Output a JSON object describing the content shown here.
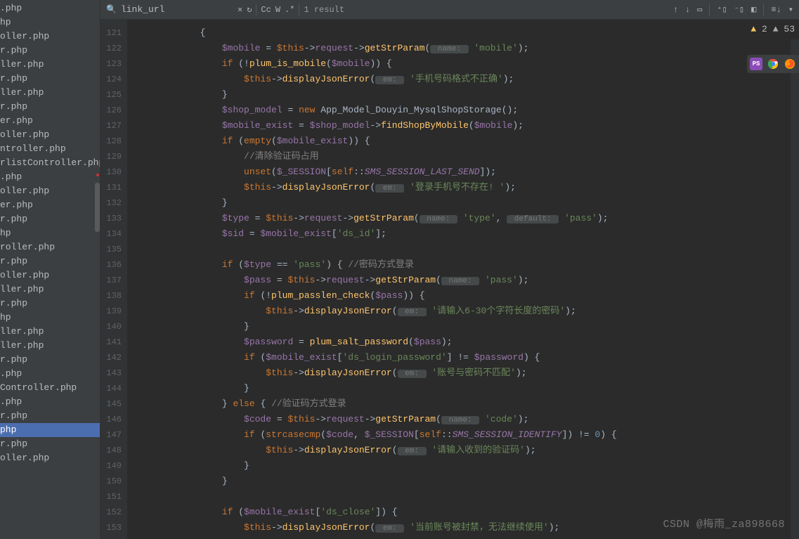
{
  "sidebar_files": [
    ".php",
    "hp",
    "oller.php",
    "r.php",
    "ller.php",
    "r.php",
    "ller.php",
    "r.php",
    "er.php",
    "oller.php",
    "ntroller.php",
    "rlistController.php",
    ".php",
    "oller.php",
    "er.php",
    "r.php",
    "hp",
    "roller.php",
    "r.php",
    "oller.php",
    "ller.php",
    "r.php",
    "hp",
    "ller.php",
    "ller.php",
    "r.php",
    ".php",
    "Controller.php",
    ".php",
    "r.php",
    "php",
    "r.php",
    "oller.php"
  ],
  "active_file_index": 30,
  "search": {
    "value": "link_url",
    "placeholder": ""
  },
  "result_text": "1 result",
  "warnings": {
    "yellow": "2",
    "gray": "53"
  },
  "watermark": "CSDN @梅雨_za898668",
  "gutter_start": 121,
  "gutter_count": 33,
  "code_lines": [
    [
      {
        "t": "            {",
        "c": "punct"
      }
    ],
    [
      {
        "t": "                ",
        "c": ""
      },
      {
        "t": "$mobile",
        "c": "var"
      },
      {
        "t": " = ",
        "c": "punct"
      },
      {
        "t": "$this",
        "c": "kw"
      },
      {
        "t": "->",
        "c": "punct"
      },
      {
        "t": "request",
        "c": "var"
      },
      {
        "t": "->",
        "c": "punct"
      },
      {
        "t": "getStrParam",
        "c": "method"
      },
      {
        "t": "(",
        "c": "punct"
      },
      {
        "t": " name: ",
        "c": "hint-box"
      },
      {
        "t": " ",
        "c": ""
      },
      {
        "t": "'mobile'",
        "c": "str"
      },
      {
        "t": ");",
        "c": "punct"
      }
    ],
    [
      {
        "t": "                ",
        "c": ""
      },
      {
        "t": "if",
        "c": "kw"
      },
      {
        "t": " (!",
        "c": "punct"
      },
      {
        "t": "plum_is_mobile",
        "c": "func"
      },
      {
        "t": "(",
        "c": "punct"
      },
      {
        "t": "$mobile",
        "c": "var"
      },
      {
        "t": ")) {",
        "c": "punct"
      }
    ],
    [
      {
        "t": "                    ",
        "c": ""
      },
      {
        "t": "$this",
        "c": "kw"
      },
      {
        "t": "->",
        "c": "punct"
      },
      {
        "t": "displayJsonError",
        "c": "method"
      },
      {
        "t": "(",
        "c": "punct"
      },
      {
        "t": " em: ",
        "c": "hint-box"
      },
      {
        "t": " ",
        "c": ""
      },
      {
        "t": "'手机号码格式不正确'",
        "c": "str"
      },
      {
        "t": ");",
        "c": "punct"
      }
    ],
    [
      {
        "t": "                }",
        "c": "punct"
      }
    ],
    [
      {
        "t": "                ",
        "c": ""
      },
      {
        "t": "$shop_model",
        "c": "var"
      },
      {
        "t": " = ",
        "c": "punct"
      },
      {
        "t": "new ",
        "c": "kw"
      },
      {
        "t": "App_Model_Douyin_MysqlShopStorage",
        "c": "classname"
      },
      {
        "t": "();",
        "c": "punct"
      }
    ],
    [
      {
        "t": "                ",
        "c": ""
      },
      {
        "t": "$mobile_exist",
        "c": "var"
      },
      {
        "t": " = ",
        "c": "punct"
      },
      {
        "t": "$shop_model",
        "c": "var"
      },
      {
        "t": "->",
        "c": "punct"
      },
      {
        "t": "findShopByMobile",
        "c": "method"
      },
      {
        "t": "(",
        "c": "punct"
      },
      {
        "t": "$mobile",
        "c": "var"
      },
      {
        "t": ");",
        "c": "punct"
      }
    ],
    [
      {
        "t": "                ",
        "c": ""
      },
      {
        "t": "if",
        "c": "kw"
      },
      {
        "t": " (",
        "c": "punct"
      },
      {
        "t": "empty",
        "c": "kw"
      },
      {
        "t": "(",
        "c": "punct"
      },
      {
        "t": "$mobile_exist",
        "c": "var"
      },
      {
        "t": ")) {",
        "c": "punct"
      }
    ],
    [
      {
        "t": "                    ",
        "c": ""
      },
      {
        "t": "//清除验证码占用",
        "c": "comment"
      }
    ],
    [
      {
        "t": "                    ",
        "c": ""
      },
      {
        "t": "unset",
        "c": "kw"
      },
      {
        "t": "(",
        "c": "punct"
      },
      {
        "t": "$_SESSION",
        "c": "var"
      },
      {
        "t": "[",
        "c": "punct"
      },
      {
        "t": "self",
        "c": "kw"
      },
      {
        "t": "::",
        "c": "punct"
      },
      {
        "t": "SMS_SESSION_LAST_SEND",
        "c": "const"
      },
      {
        "t": "]);",
        "c": "punct"
      }
    ],
    [
      {
        "t": "                    ",
        "c": ""
      },
      {
        "t": "$this",
        "c": "kw"
      },
      {
        "t": "->",
        "c": "punct"
      },
      {
        "t": "displayJsonError",
        "c": "method"
      },
      {
        "t": "(",
        "c": "punct"
      },
      {
        "t": " em: ",
        "c": "hint-box"
      },
      {
        "t": " ",
        "c": ""
      },
      {
        "t": "'登录手机号不存在! '",
        "c": "str"
      },
      {
        "t": ");",
        "c": "punct"
      }
    ],
    [
      {
        "t": "                }",
        "c": "punct"
      }
    ],
    [
      {
        "t": "                ",
        "c": ""
      },
      {
        "t": "$type",
        "c": "var"
      },
      {
        "t": " = ",
        "c": "punct"
      },
      {
        "t": "$this",
        "c": "kw"
      },
      {
        "t": "->",
        "c": "punct"
      },
      {
        "t": "request",
        "c": "var"
      },
      {
        "t": "->",
        "c": "punct"
      },
      {
        "t": "getStrParam",
        "c": "method"
      },
      {
        "t": "(",
        "c": "punct"
      },
      {
        "t": " name: ",
        "c": "hint-box"
      },
      {
        "t": " ",
        "c": ""
      },
      {
        "t": "'type'",
        "c": "str"
      },
      {
        "t": ", ",
        "c": "punct"
      },
      {
        "t": " default: ",
        "c": "hint-box"
      },
      {
        "t": " ",
        "c": ""
      },
      {
        "t": "'pass'",
        "c": "str"
      },
      {
        "t": ");",
        "c": "punct"
      }
    ],
    [
      {
        "t": "                ",
        "c": ""
      },
      {
        "t": "$sid",
        "c": "var"
      },
      {
        "t": " = ",
        "c": "punct"
      },
      {
        "t": "$mobile_exist",
        "c": "var"
      },
      {
        "t": "[",
        "c": "punct"
      },
      {
        "t": "'ds_id'",
        "c": "str"
      },
      {
        "t": "];",
        "c": "punct"
      }
    ],
    [
      {
        "t": "",
        "c": ""
      }
    ],
    [
      {
        "t": "                ",
        "c": ""
      },
      {
        "t": "if",
        "c": "kw"
      },
      {
        "t": " (",
        "c": "punct"
      },
      {
        "t": "$type",
        "c": "var"
      },
      {
        "t": " == ",
        "c": "punct"
      },
      {
        "t": "'pass'",
        "c": "str"
      },
      {
        "t": ") { ",
        "c": "punct"
      },
      {
        "t": "//密码方式登录",
        "c": "comment"
      }
    ],
    [
      {
        "t": "                    ",
        "c": ""
      },
      {
        "t": "$pass",
        "c": "var"
      },
      {
        "t": " = ",
        "c": "punct"
      },
      {
        "t": "$this",
        "c": "kw"
      },
      {
        "t": "->",
        "c": "punct"
      },
      {
        "t": "request",
        "c": "var"
      },
      {
        "t": "->",
        "c": "punct"
      },
      {
        "t": "getStrParam",
        "c": "method"
      },
      {
        "t": "(",
        "c": "punct"
      },
      {
        "t": " name: ",
        "c": "hint-box"
      },
      {
        "t": " ",
        "c": ""
      },
      {
        "t": "'pass'",
        "c": "str"
      },
      {
        "t": ");",
        "c": "punct"
      }
    ],
    [
      {
        "t": "                    ",
        "c": ""
      },
      {
        "t": "if",
        "c": "kw"
      },
      {
        "t": " (!",
        "c": "punct"
      },
      {
        "t": "plum_passlen_check",
        "c": "func"
      },
      {
        "t": "(",
        "c": "punct"
      },
      {
        "t": "$pass",
        "c": "var"
      },
      {
        "t": ")) {",
        "c": "punct"
      }
    ],
    [
      {
        "t": "                        ",
        "c": ""
      },
      {
        "t": "$this",
        "c": "kw"
      },
      {
        "t": "->",
        "c": "punct"
      },
      {
        "t": "displayJsonError",
        "c": "method"
      },
      {
        "t": "(",
        "c": "punct"
      },
      {
        "t": " em: ",
        "c": "hint-box"
      },
      {
        "t": " ",
        "c": ""
      },
      {
        "t": "'请输入6-30个字符长度的密码'",
        "c": "str"
      },
      {
        "t": ");",
        "c": "punct"
      }
    ],
    [
      {
        "t": "                    }",
        "c": "punct"
      }
    ],
    [
      {
        "t": "                    ",
        "c": ""
      },
      {
        "t": "$password",
        "c": "var"
      },
      {
        "t": " = ",
        "c": "punct"
      },
      {
        "t": "plum_salt_password",
        "c": "func"
      },
      {
        "t": "(",
        "c": "punct"
      },
      {
        "t": "$pass",
        "c": "var"
      },
      {
        "t": ");",
        "c": "punct"
      }
    ],
    [
      {
        "t": "                    ",
        "c": ""
      },
      {
        "t": "if",
        "c": "kw"
      },
      {
        "t": " (",
        "c": "punct"
      },
      {
        "t": "$mobile_exist",
        "c": "var"
      },
      {
        "t": "[",
        "c": "punct"
      },
      {
        "t": "'ds_login_password'",
        "c": "str"
      },
      {
        "t": "] != ",
        "c": "punct"
      },
      {
        "t": "$password",
        "c": "var"
      },
      {
        "t": ") {",
        "c": "punct"
      }
    ],
    [
      {
        "t": "                        ",
        "c": ""
      },
      {
        "t": "$this",
        "c": "kw"
      },
      {
        "t": "->",
        "c": "punct"
      },
      {
        "t": "displayJsonError",
        "c": "method"
      },
      {
        "t": "(",
        "c": "punct"
      },
      {
        "t": " em: ",
        "c": "hint-box"
      },
      {
        "t": " ",
        "c": ""
      },
      {
        "t": "'账号与密码不匹配'",
        "c": "str"
      },
      {
        "t": ");",
        "c": "punct"
      }
    ],
    [
      {
        "t": "                    }",
        "c": "punct"
      }
    ],
    [
      {
        "t": "                } ",
        "c": "punct"
      },
      {
        "t": "else",
        "c": "kw"
      },
      {
        "t": " { ",
        "c": "punct"
      },
      {
        "t": "//验证码方式登录",
        "c": "comment"
      }
    ],
    [
      {
        "t": "                    ",
        "c": ""
      },
      {
        "t": "$code",
        "c": "var"
      },
      {
        "t": " = ",
        "c": "punct"
      },
      {
        "t": "$this",
        "c": "kw"
      },
      {
        "t": "->",
        "c": "punct"
      },
      {
        "t": "request",
        "c": "var"
      },
      {
        "t": "->",
        "c": "punct"
      },
      {
        "t": "getStrParam",
        "c": "method"
      },
      {
        "t": "(",
        "c": "punct"
      },
      {
        "t": " name: ",
        "c": "hint-box"
      },
      {
        "t": " ",
        "c": ""
      },
      {
        "t": "'code'",
        "c": "str"
      },
      {
        "t": ");",
        "c": "punct"
      }
    ],
    [
      {
        "t": "                    ",
        "c": ""
      },
      {
        "t": "if",
        "c": "kw"
      },
      {
        "t": " (",
        "c": "punct"
      },
      {
        "t": "strcasecmp",
        "c": "kw"
      },
      {
        "t": "(",
        "c": "punct"
      },
      {
        "t": "$code",
        "c": "var"
      },
      {
        "t": ", ",
        "c": "punct"
      },
      {
        "t": "$_SESSION",
        "c": "var"
      },
      {
        "t": "[",
        "c": "punct"
      },
      {
        "t": "self",
        "c": "kw"
      },
      {
        "t": "::",
        "c": "punct"
      },
      {
        "t": "SMS_SESSION_IDENTIFY",
        "c": "const"
      },
      {
        "t": "]) != ",
        "c": "punct"
      },
      {
        "t": "0",
        "c": "num"
      },
      {
        "t": ") {",
        "c": "punct"
      }
    ],
    [
      {
        "t": "                        ",
        "c": ""
      },
      {
        "t": "$this",
        "c": "kw"
      },
      {
        "t": "->",
        "c": "punct"
      },
      {
        "t": "displayJsonError",
        "c": "method"
      },
      {
        "t": "(",
        "c": "punct"
      },
      {
        "t": " em: ",
        "c": "hint-box"
      },
      {
        "t": " ",
        "c": ""
      },
      {
        "t": "'请输入收到的验证码'",
        "c": "str"
      },
      {
        "t": ");",
        "c": "punct"
      }
    ],
    [
      {
        "t": "                    }",
        "c": "punct"
      }
    ],
    [
      {
        "t": "                }",
        "c": "punct"
      }
    ],
    [
      {
        "t": "",
        "c": ""
      }
    ],
    [
      {
        "t": "                ",
        "c": ""
      },
      {
        "t": "if",
        "c": "kw"
      },
      {
        "t": " (",
        "c": "punct"
      },
      {
        "t": "$mobile_exist",
        "c": "var"
      },
      {
        "t": "[",
        "c": "punct"
      },
      {
        "t": "'ds_close'",
        "c": "str"
      },
      {
        "t": "]) {",
        "c": "punct"
      }
    ],
    [
      {
        "t": "                    ",
        "c": ""
      },
      {
        "t": "$this",
        "c": "kw"
      },
      {
        "t": "->",
        "c": "punct"
      },
      {
        "t": "displayJsonError",
        "c": "method"
      },
      {
        "t": "(",
        "c": "punct"
      },
      {
        "t": " em: ",
        "c": "hint-box"
      },
      {
        "t": " ",
        "c": ""
      },
      {
        "t": "'当前账号被封禁，无法继续使用'",
        "c": "str"
      },
      {
        "t": ");",
        "c": "punct"
      }
    ]
  ]
}
